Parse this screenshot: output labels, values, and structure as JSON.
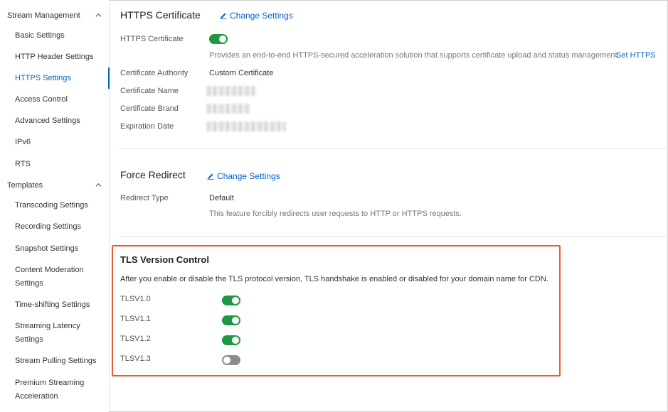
{
  "sidebar": {
    "groups": [
      {
        "label": "Stream Management"
      },
      {
        "label": "Templates"
      }
    ],
    "stream_items": [
      {
        "label": "Basic Settings"
      },
      {
        "label": "HTTP Header Settings"
      },
      {
        "label": "HTTPS Settings"
      },
      {
        "label": "Access Control"
      },
      {
        "label": "Advanced Settings"
      },
      {
        "label": "IPv6"
      },
      {
        "label": "RTS"
      }
    ],
    "template_items": [
      {
        "label": "Transcoding Settings"
      },
      {
        "label": "Recording Settings"
      },
      {
        "label": "Snapshot Settings"
      },
      {
        "label": "Content Moderation",
        "label2": "Settings"
      },
      {
        "label": "Time-shifting Settings"
      },
      {
        "label": "Streaming Latency",
        "label2": "Settings"
      },
      {
        "label": "Stream Pulling Settings"
      },
      {
        "label": "Premium Streaming",
        "label2": "Acceleration"
      }
    ],
    "active_item": "HTTPS Settings"
  },
  "https_section": {
    "title": "HTTPS Certificate",
    "change_label": "Change Settings",
    "cert_label": "HTTPS Certificate",
    "cert_enabled": true,
    "cert_desc": "Provides an end-to-end HTTPS-secured acceleration solution that supports certificate upload and status management.",
    "set_https_label": "Set HTTPS",
    "authority_label": "Certificate Authority",
    "authority_value": "Custom Certificate",
    "name_label": "Certificate Name",
    "brand_label": "Certificate Brand",
    "expiration_label": "Expiration Date"
  },
  "redirect_section": {
    "title": "Force Redirect",
    "change_label": "Change Settings",
    "type_label": "Redirect Type",
    "type_value": "Default",
    "desc": "This feature forcibly redirects user requests to HTTP or HTTPS requests."
  },
  "tls_section": {
    "title": "TLS Version Control",
    "desc": "After you enable or disable the TLS protocol version, TLS handshake is enabled or disabled for your domain name for CDN.",
    "versions": [
      {
        "label": "TLSV1.0",
        "enabled": true
      },
      {
        "label": "TLSV1.1",
        "enabled": true
      },
      {
        "label": "TLSV1.2",
        "enabled": true
      },
      {
        "label": "TLSV1.3",
        "enabled": false
      }
    ]
  },
  "colors": {
    "accent": "#0064c8",
    "toggle_on": "#1e9941",
    "toggle_off": "#8c8c8c",
    "highlight": "#e85a3c"
  }
}
